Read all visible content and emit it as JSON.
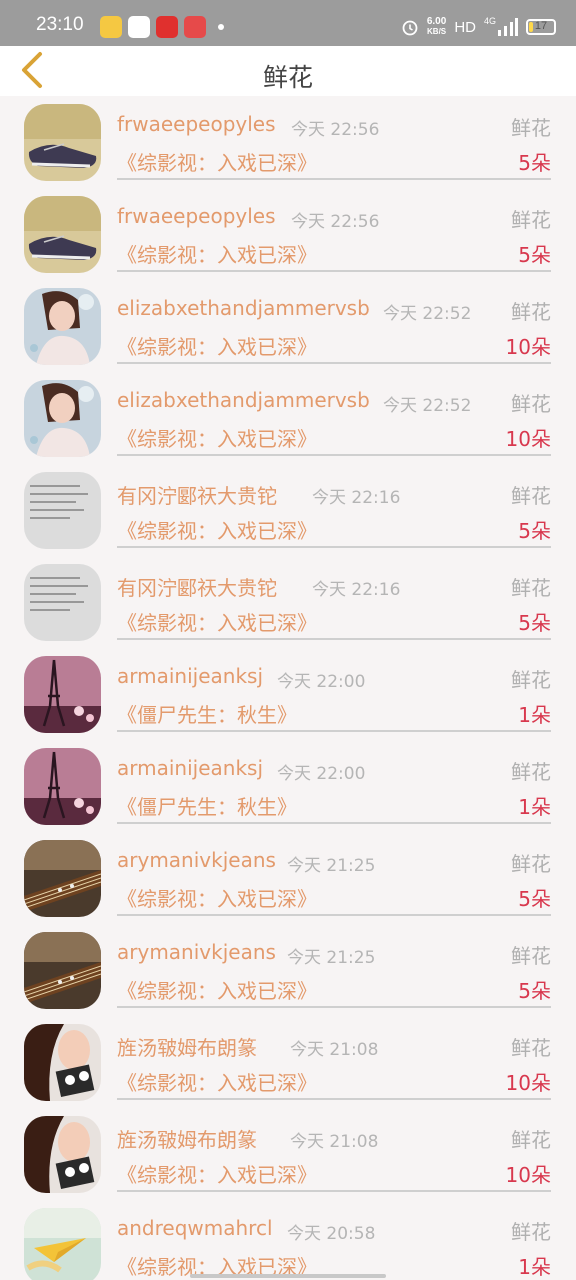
{
  "status": {
    "time": "23:10",
    "speed_value": "6.00",
    "speed_unit": "KB/S",
    "hd": "HD",
    "network": "4G",
    "battery": "17"
  },
  "header": {
    "title": "鲜花",
    "back_icon": "chevron-left-icon"
  },
  "colors": {
    "name": "#e39a6c",
    "count": "#d8384e",
    "time": "#b5b5b5",
    "gift": "#b0b0b0",
    "background": "#f7f4f4"
  },
  "items": [
    {
      "user": "frwaeepeopyles",
      "time": "今天 22:56",
      "gift": "鲜花",
      "show": "《综影视：入戏已深》",
      "count": "5朵",
      "avatar": "sneakers-avatar"
    },
    {
      "user": "frwaeepeopyles",
      "time": "今天 22:56",
      "gift": "鲜花",
      "show": "《综影视：入戏已深》",
      "count": "5朵",
      "avatar": "sneakers-avatar"
    },
    {
      "user": "elizabxethandjammervsb",
      "time": "今天 22:52",
      "gift": "鲜花",
      "show": "《综影视：入戏已深》",
      "count": "10朵",
      "avatar": "girl-avatar"
    },
    {
      "user": "elizabxethandjammervsb",
      "time": "今天 22:52",
      "gift": "鲜花",
      "show": "《综影视：入戏已深》",
      "count": "10朵",
      "avatar": "girl-avatar"
    },
    {
      "user": "有冈泞郾祆大贵铊",
      "time": "今天 22:16",
      "gift": "鲜花",
      "show": "《综影视：入戏已深》",
      "count": "5朵",
      "avatar": "text-avatar"
    },
    {
      "user": "有冈泞郾祆大贵铊",
      "time": "今天 22:16",
      "gift": "鲜花",
      "show": "《综影视：入戏已深》",
      "count": "5朵",
      "avatar": "text-avatar"
    },
    {
      "user": "armainijeanksj",
      "time": "今天 22:00",
      "gift": "鲜花",
      "show": "《僵尸先生：秋生》",
      "count": "1朵",
      "avatar": "eiffel-avatar"
    },
    {
      "user": "armainijeanksj",
      "time": "今天 22:00",
      "gift": "鲜花",
      "show": "《僵尸先生：秋生》",
      "count": "1朵",
      "avatar": "eiffel-avatar"
    },
    {
      "user": "arymanivkjeans",
      "time": "今天 21:25",
      "gift": "鲜花",
      "show": "《综影视：入戏已深》",
      "count": "5朵",
      "avatar": "guitar-avatar"
    },
    {
      "user": "arymanivkjeans",
      "time": "今天 21:25",
      "gift": "鲜花",
      "show": "《综影视：入戏已深》",
      "count": "5朵",
      "avatar": "guitar-avatar"
    },
    {
      "user": "旌汤皲姆布朗篆",
      "time": "今天 21:08",
      "gift": "鲜花",
      "show": "《综影视：入戏已深》",
      "count": "10朵",
      "avatar": "woman-avatar"
    },
    {
      "user": "旌汤皲姆布朗篆",
      "time": "今天 21:08",
      "gift": "鲜花",
      "show": "《综影视：入戏已深》",
      "count": "10朵",
      "avatar": "woman-avatar"
    },
    {
      "user": "andreqwmahrcl",
      "time": "今天 20:58",
      "gift": "鲜花",
      "show": "《综影视：入戏已深》",
      "count": "1朵",
      "avatar": "plane-avatar"
    }
  ]
}
